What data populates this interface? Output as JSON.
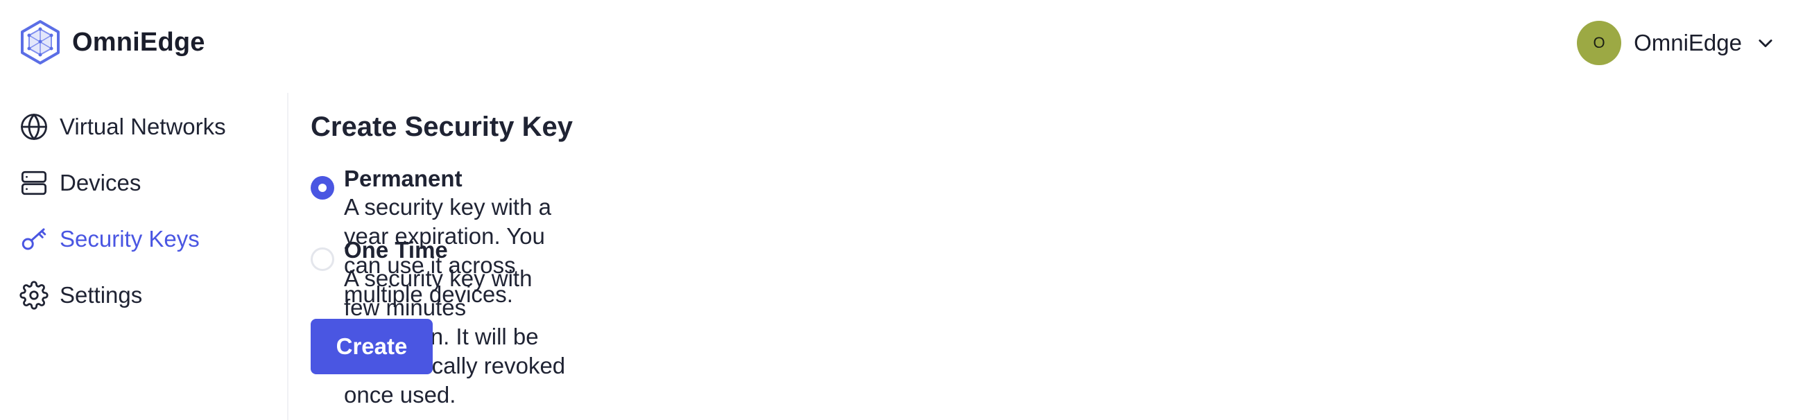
{
  "brand": {
    "name": "OmniEdge",
    "logo_icon": "cube-hexagon-icon",
    "color": "#5b6ee6"
  },
  "user": {
    "initial": "O",
    "name": "OmniEdge",
    "avatar_color": "#9ca944",
    "menu_icon": "chevron-down-icon"
  },
  "sidebar": {
    "items": [
      {
        "label": "Virtual Networks",
        "icon": "globe-icon",
        "active": false
      },
      {
        "label": "Devices",
        "icon": "server-icon",
        "active": false
      },
      {
        "label": "Security Keys",
        "icon": "key-icon",
        "active": true
      },
      {
        "label": "Settings",
        "icon": "gear-icon",
        "active": false
      }
    ]
  },
  "main": {
    "title": "Create Security Key",
    "options": [
      {
        "title": "Permanent",
        "description": "A security key with a year expiration. You can use it across multiple devices.",
        "selected": true
      },
      {
        "title": "One Time",
        "description": "A security key with few minutes expiration. It will be automatically revoked once used.",
        "selected": false
      }
    ],
    "create_label": "Create"
  },
  "colors": {
    "accent": "#4a56e2",
    "text": "#1f2333",
    "divider": "#f0f1f4"
  }
}
